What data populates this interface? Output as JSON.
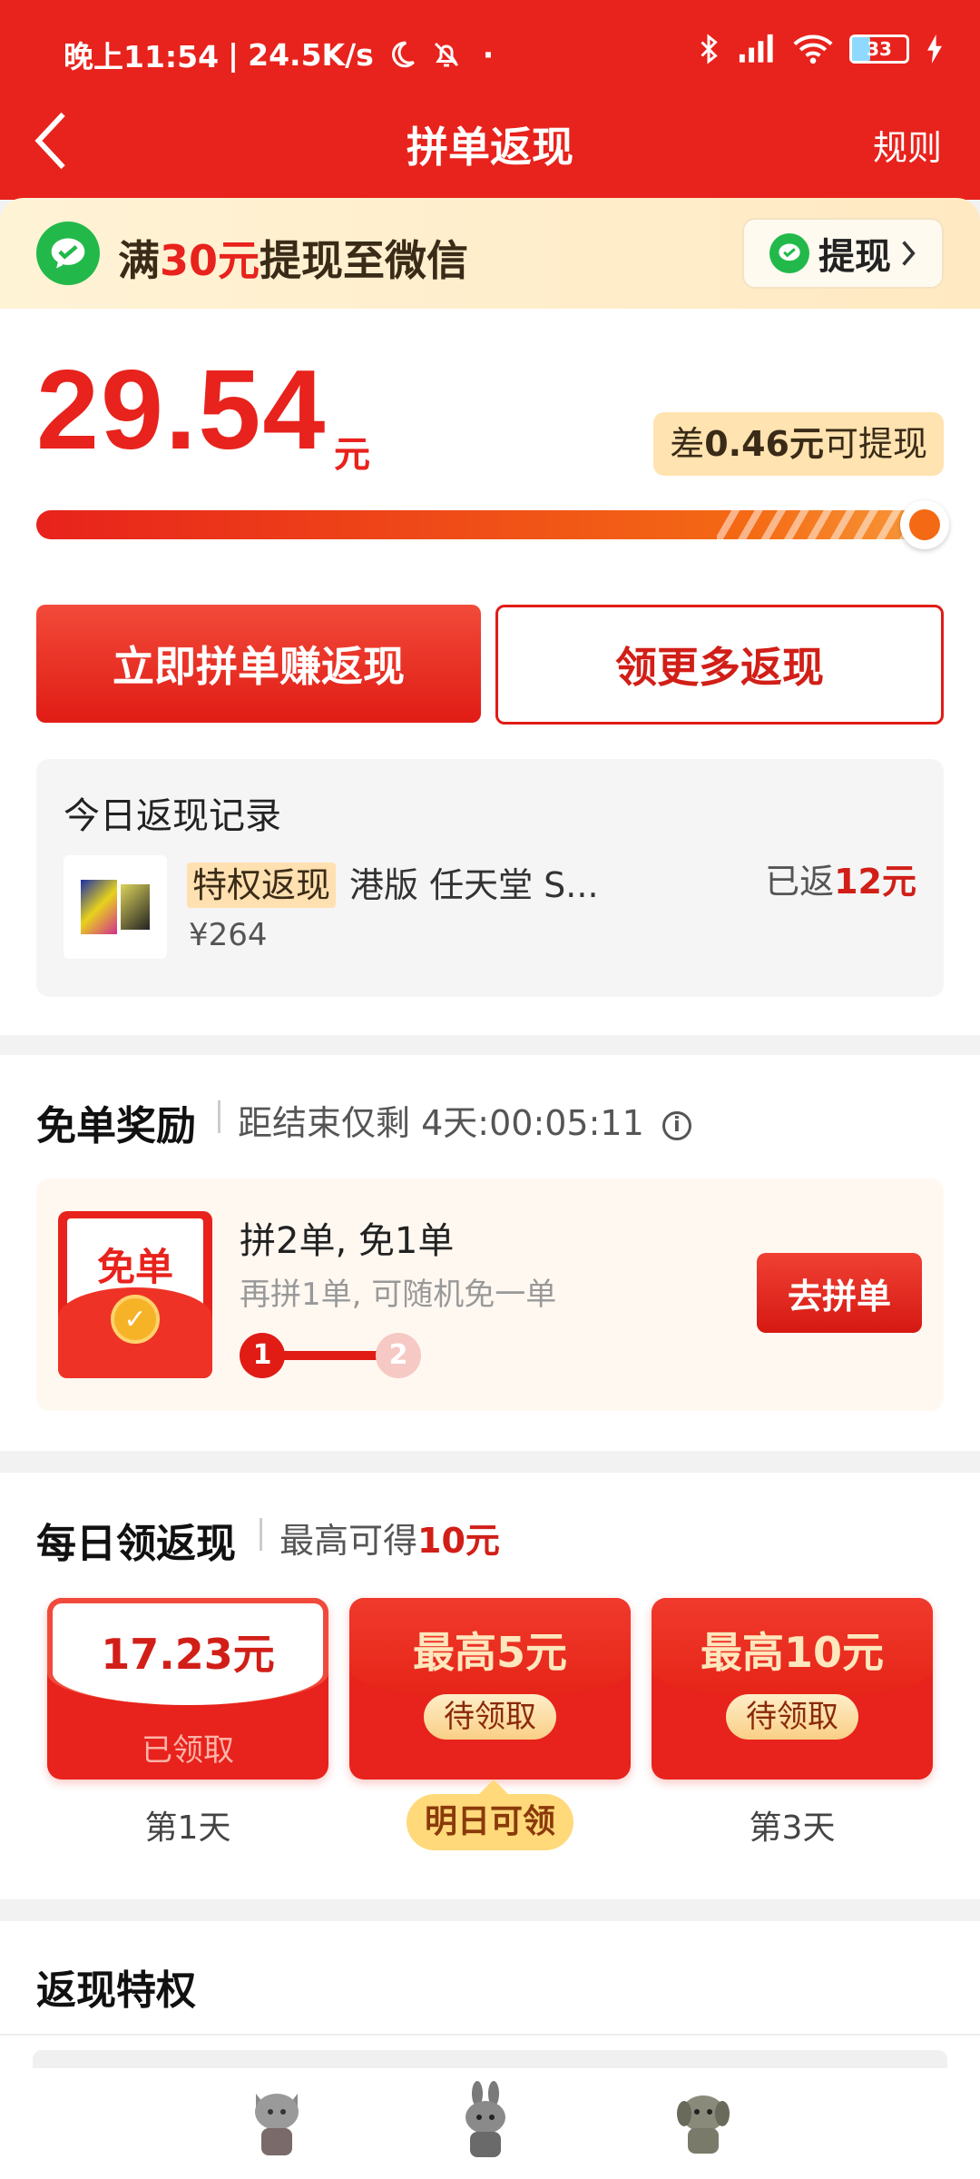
{
  "status_bar": {
    "time": "晚上11:54",
    "net_speed": "24.5K/s",
    "battery": "33"
  },
  "nav": {
    "title": "拼单返现",
    "rules": "规则"
  },
  "wechat_banner": {
    "prefix": "满",
    "amount": "30元",
    "suffix": "提现至微信",
    "button": "提现"
  },
  "balance": {
    "amount": "29.54",
    "unit": "元",
    "diff_prefix": "差",
    "diff_value": "0.46元",
    "diff_suffix": "可提现",
    "progress": 0.985
  },
  "actions": {
    "primary": "立即拼单赚返现",
    "secondary": "领更多返现"
  },
  "today_records": {
    "title": "今日返现记录",
    "items": [
      {
        "tag": "特权返现",
        "name": "港版 任天堂 S...",
        "price": "¥264",
        "returned_prefix": "已返",
        "returned_value": "12元"
      }
    ]
  },
  "free_order": {
    "title": "免单奖励",
    "countdown_prefix": "距结束仅剩",
    "countdown": "4天:00:05:11",
    "envelope_label": "免单",
    "headline": "拼2单, 免1单",
    "subline": "再拼1单, 可随机免一单",
    "steps": [
      "1",
      "2"
    ],
    "button": "去拼单"
  },
  "daily": {
    "title": "每日领返现",
    "sub_prefix": "最高可得",
    "sub_value": "10元",
    "tiles": [
      {
        "value": "17.23元",
        "status": "已领取",
        "label": "第1天"
      },
      {
        "value": "最高5元",
        "status": "待领取",
        "label": "明日可领"
      },
      {
        "value": "最高10元",
        "status": "待领取",
        "label": "第3天"
      }
    ]
  },
  "privileges": {
    "title": "返现特权"
  },
  "colors": {
    "brand_red": "#e8221c",
    "wechat_green": "#22b94a",
    "badge_cream": "#ffe3b0"
  }
}
